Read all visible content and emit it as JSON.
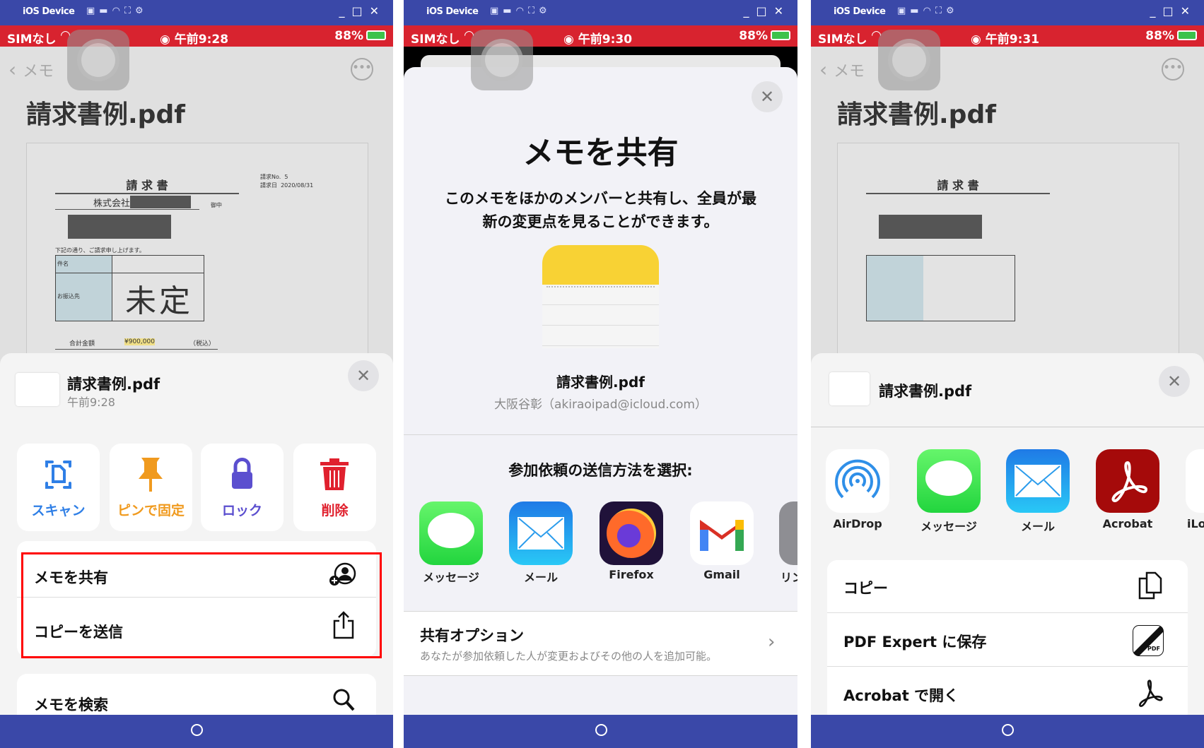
{
  "window": {
    "title": "iOS Device",
    "toolbar_icons": [
      "camera-icon",
      "video-icon",
      "headphones-icon",
      "fullscreen-icon",
      "gear-icon"
    ],
    "controls": [
      "minimize",
      "maximize",
      "close"
    ]
  },
  "colors": {
    "titlebar": "#3a48a8",
    "statusbar": "#d8232f",
    "highlight": "#ff0000",
    "scan": "#2f7fe6",
    "pin": "#f09a1e",
    "lock": "#5b4fcf",
    "delete": "#e0212e"
  },
  "panels": [
    {
      "status": {
        "carrier": "SIMなし",
        "time": "午前9:28",
        "battery": "88%"
      },
      "nav": {
        "back_label": "メモ"
      },
      "note_title": "請求書例.pdf",
      "document": {
        "heading": "請 求 書",
        "no_label": "請求No.",
        "no_value": "5",
        "date_label": "請求日",
        "date_value": "2020/08/31",
        "company": "株式会社",
        "honorific": "御中",
        "intro": "下記の通り、ご請求申し上げます。",
        "subject_label": "件名",
        "payee_label": "お振込先",
        "handwriting": "未定",
        "total_label": "合計金額",
        "total_value": "¥900,000",
        "tax_note": "（税込）"
      },
      "sheet": {
        "title": "請求書例.pdf",
        "subtitle": "午前9:28",
        "actions": [
          {
            "label": "スキャン",
            "icon": "scan-icon"
          },
          {
            "label": "ピンで固定",
            "icon": "pin-icon"
          },
          {
            "label": "ロック",
            "icon": "lock-icon"
          },
          {
            "label": "削除",
            "icon": "trash-icon"
          }
        ],
        "rows": [
          {
            "label": "メモを共有",
            "icon": "share-person-icon"
          },
          {
            "label": "コピーを送信",
            "icon": "share-icon"
          }
        ],
        "search_row": {
          "label": "メモを検索",
          "icon": "search-icon"
        }
      }
    },
    {
      "status": {
        "carrier": "SIMなし",
        "time": "午前9:30",
        "battery": "88%"
      },
      "share": {
        "title": "メモを共有",
        "description_1": "このメモをほかのメンバーと共有し、全員が最",
        "description_2": "新の変更点を見ることができます。",
        "file": "請求書例.pdf",
        "owner": "大阪谷彰（akiraoipad@icloud.com）",
        "method_label": "参加依頼の送信方法を選択:",
        "apps": [
          {
            "label": "メッセージ"
          },
          {
            "label": "メール"
          },
          {
            "label": "Firefox"
          },
          {
            "label": "Gmail"
          },
          {
            "label": "リンク"
          }
        ],
        "options_title": "共有オプション",
        "options_sub": "あなたが参加依頼した人が変更およびその他の人を追加可能。"
      }
    },
    {
      "status": {
        "carrier": "SIMなし",
        "time": "午前9:31",
        "battery": "88%"
      },
      "nav": {
        "back_label": "メモ"
      },
      "note_title": "請求書例.pdf",
      "sheet": {
        "title": "請求書例.pdf",
        "apps": [
          {
            "label": "AirDrop"
          },
          {
            "label": "メッセージ"
          },
          {
            "label": "メール"
          },
          {
            "label": "Acrobat"
          },
          {
            "label": "iLo"
          }
        ],
        "rows": [
          {
            "label": "コピー",
            "icon": "copy-icon"
          },
          {
            "label": "PDF Expert に保存",
            "icon": "pdf-expert-icon"
          },
          {
            "label": "Acrobat で開く",
            "icon": "acrobat-icon"
          }
        ]
      }
    }
  ]
}
